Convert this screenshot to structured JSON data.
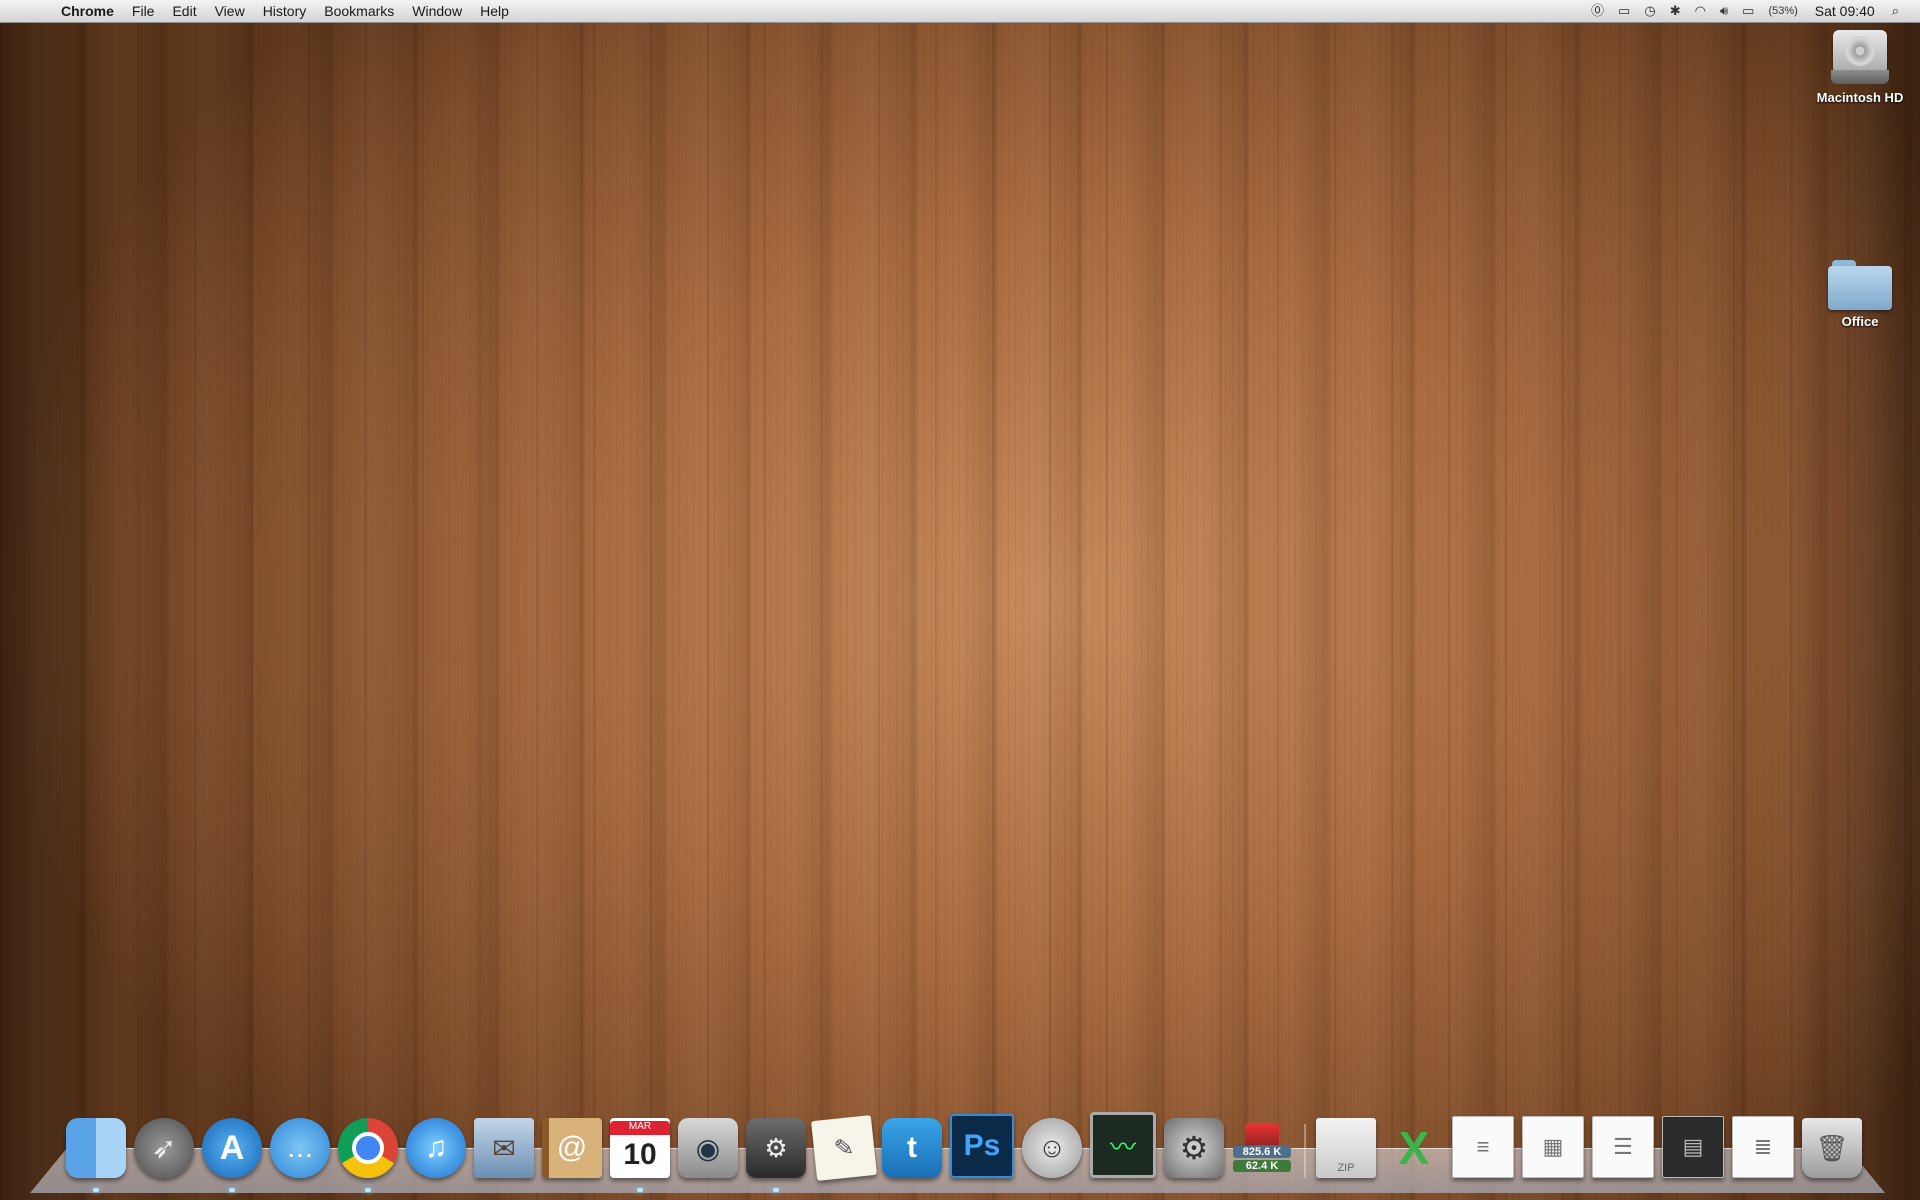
{
  "menubar": {
    "apple_icon": "",
    "app_name": "Chrome",
    "items": [
      "File",
      "Edit",
      "View",
      "History",
      "Bookmarks",
      "Window",
      "Help"
    ],
    "status": {
      "battery_percent": "(53%)",
      "clock": "Sat 09:40"
    }
  },
  "desktop": {
    "icons": [
      {
        "label": "Macintosh HD",
        "icon": "hard-drive-icon"
      },
      {
        "label": "Office",
        "icon": "folder-icon"
      }
    ]
  },
  "dock": {
    "calendar": {
      "month": "MAR",
      "day": "10"
    },
    "network_monitor": {
      "download": "825.6 K",
      "upload": "62.4 K"
    },
    "zip_label": "ZIP"
  }
}
